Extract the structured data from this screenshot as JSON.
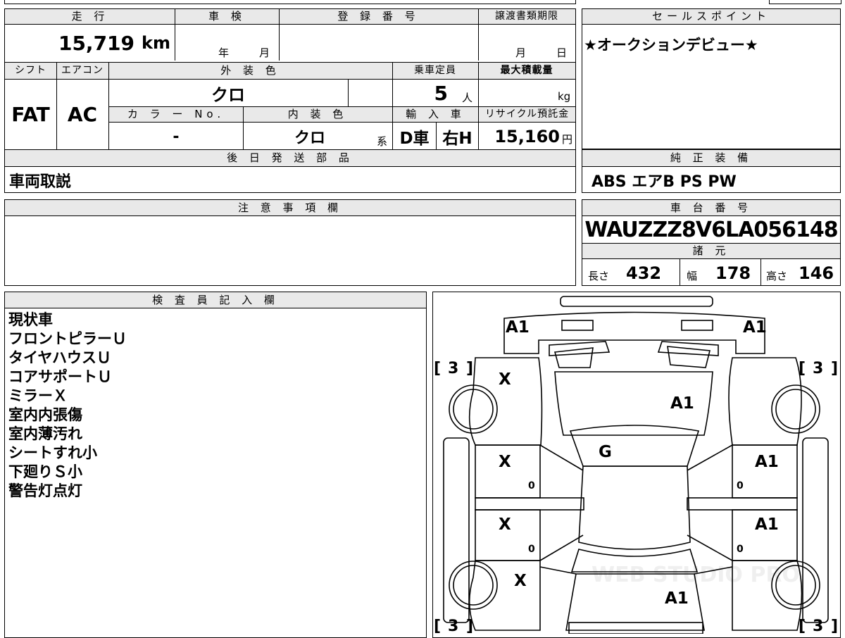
{
  "sheet": {
    "mileage_label": "走 行",
    "mileage_value": "15,719",
    "mileage_unit": "km",
    "shaken_label": "車 検",
    "shaken_year": "年",
    "shaken_month": "月",
    "reg_no_label": "登 録 番 号",
    "transfer_label": "譲渡書類期限",
    "transfer_month": "月",
    "transfer_day": "日",
    "shift_label": "シフト",
    "aircon_label": "エアコン",
    "exterior_color_label": "外 装 色",
    "capacity_label": "乗車定員",
    "max_load_label": "最大積載量",
    "shift_value": "FAT",
    "aircon_value": "AC",
    "exterior_color_value": "クロ",
    "capacity_value": "5",
    "capacity_unit": "人",
    "max_load_unit": "kg",
    "color_no_label": "カ ラ ー No.",
    "interior_color_label": "内 装 色",
    "import_label": "輸 入 車",
    "recycle_label": "リサイクル預託金",
    "color_no_value": "-",
    "interior_color_value": "クロ",
    "interior_suffix": "系",
    "import_dealer": "D車",
    "import_handle": "右H",
    "recycle_value": "15,160",
    "recycle_unit": "円",
    "later_parts_label": "後 日 発 送 部 品",
    "later_parts_value": "車両取説",
    "notes_label": "注 意 事 項 欄",
    "inspector_label": "検 査 員 記 入 欄"
  },
  "sales_point": {
    "label": "セールスポイント",
    "text": "★オークションデビュー★"
  },
  "equipment": {
    "label": "純 正 装 備",
    "items": "ABS エアB PS PW"
  },
  "chassis": {
    "label": "車 台 番 号",
    "number": "WAUZZZ8V6LA056148"
  },
  "specs": {
    "label": "諸 元",
    "length_label": "長さ",
    "length_value": "432",
    "width_label": "幅",
    "width_value": "178",
    "height_label": "高さ",
    "height_value": "146"
  },
  "inspector_notes": [
    "現状車",
    "フロントピラーＵ",
    "タイヤハウスＵ",
    "コアサポートＵ",
    "ミラーＸ",
    "室内内張傷",
    "室内薄汚れ",
    "シートすれ小",
    "下廻りＳ小",
    "警告灯点灯"
  ],
  "diagram_marks": {
    "front_left_pillar": "A1",
    "front_right_pillar": "A1",
    "tire_fl": "3",
    "tire_fr": "3",
    "tire_rl": "3",
    "tire_rr": "3",
    "fender_fl": "X",
    "hood": "A1",
    "windshield": "G",
    "door_fl": "X",
    "door_fr": "A1",
    "door_rl": "X",
    "door_rr": "A1",
    "step_fl": "0",
    "step_fr": "0",
    "step_rl": "0",
    "step_rr": "0",
    "quarter_rl": "X",
    "trunk": "A1",
    "watermark": "WEB STUDIO PRO"
  }
}
